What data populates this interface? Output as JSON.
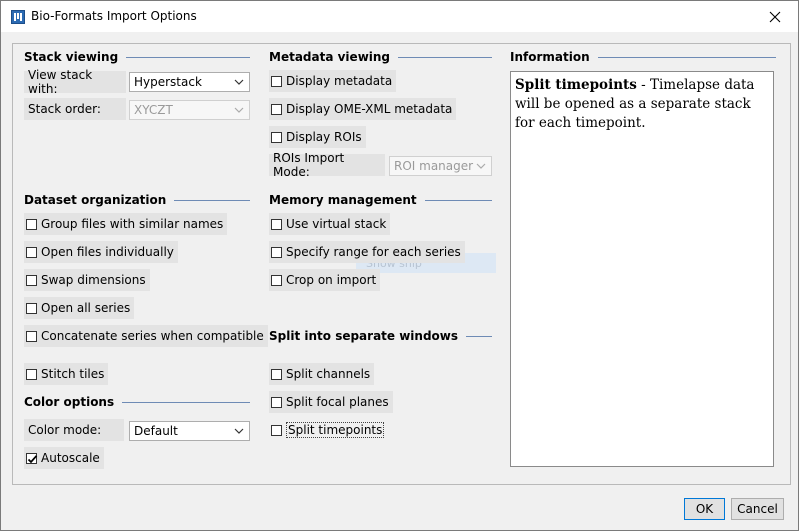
{
  "window": {
    "title": "Bio-Formats Import Options"
  },
  "sections": {
    "stack_viewing": "Stack viewing",
    "metadata_viewing": "Metadata viewing",
    "information": "Information",
    "dataset_organization": "Dataset organization",
    "memory_management": "Memory management",
    "split_windows": "Split into separate windows",
    "color_options": "Color options"
  },
  "stack": {
    "view_with_label": "View stack with:",
    "view_with_value": "Hyperstack",
    "order_label": "Stack order:",
    "order_value": "XYCZT"
  },
  "metadata": {
    "display_metadata": "Display metadata",
    "display_omexml": "Display OME-XML metadata",
    "display_rois": "Display ROIs",
    "roi_mode_label": "ROIs Import Mode:",
    "roi_mode_value": "ROI manager"
  },
  "dataset": {
    "group_files": "Group files with similar names",
    "open_individually": "Open files individually",
    "swap_dimensions": "Swap dimensions",
    "open_all_series": "Open all series",
    "concatenate": "Concatenate series when compatible",
    "stitch_tiles": "Stitch tiles"
  },
  "memory": {
    "virtual_stack": "Use virtual stack",
    "specify_range": "Specify range for each series",
    "crop": "Crop on import"
  },
  "split": {
    "channels": "Split channels",
    "focal_planes": "Split focal planes",
    "timepoints": "Split timepoints"
  },
  "color": {
    "mode_label": "Color mode:",
    "mode_value": "Default",
    "autoscale": "Autoscale",
    "autoscale_checked": true
  },
  "info": {
    "heading": "Split timepoints",
    "text": " - Timelapse data will be opened as a separate stack for each timepoint."
  },
  "ghost_text": "Show ship",
  "buttons": {
    "ok": "OK",
    "cancel": "Cancel"
  }
}
